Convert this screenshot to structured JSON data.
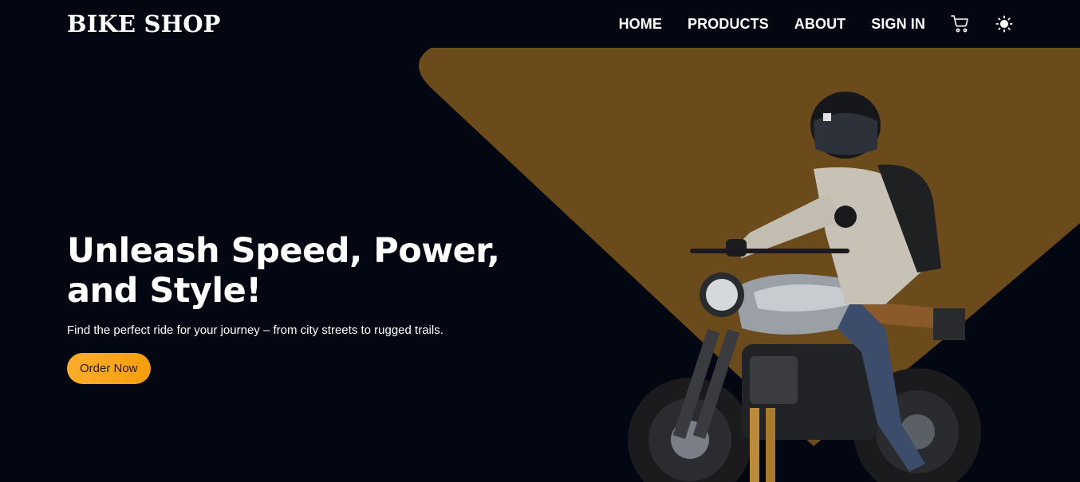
{
  "brand": "BIKE SHOP",
  "nav": {
    "home": "HOME",
    "products": "PRODUCTS",
    "about": "ABOUT",
    "signin": "SIGN IN",
    "cart_icon": "cart-icon",
    "theme_icon": "sun-icon"
  },
  "hero": {
    "title_line1": "Unleash Speed, Power,",
    "title_line2": "and Style!",
    "subtitle": "Find the perfect ride for your journey – from city streets to rugged trails.",
    "cta_label": "Order Now"
  },
  "colors": {
    "background": "#030712",
    "accent_shape": "#6b4a1c",
    "cta": "#fbae2c"
  }
}
